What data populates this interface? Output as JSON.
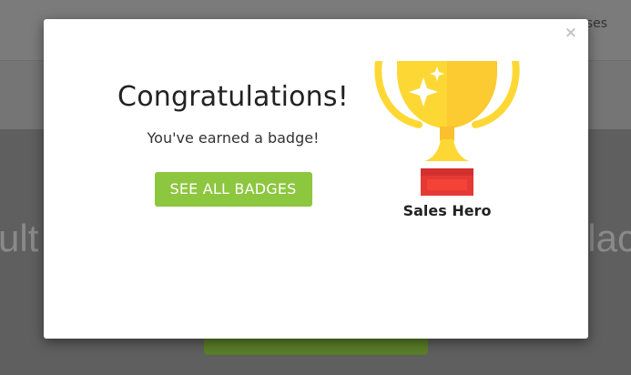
{
  "background": {
    "nav_text": "ses",
    "hero_left_text": "ult",
    "hero_right_text": "lac"
  },
  "modal": {
    "close_label": "×",
    "title": "Congratulations!",
    "subtitle": "You've earned a badge!",
    "button_label": "SEE ALL BADGES",
    "badge": {
      "name": "Sales Hero",
      "icon": "trophy-icon"
    }
  },
  "colors": {
    "accent_green": "#8dc63f",
    "trophy_gold": "#fdd835",
    "trophy_base_red": "#e53935"
  }
}
